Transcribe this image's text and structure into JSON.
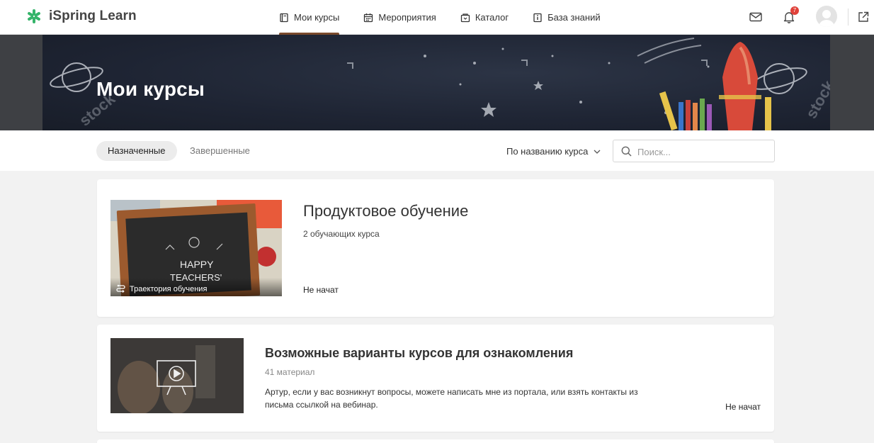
{
  "app": {
    "logo_text": "iSpring Learn"
  },
  "nav": {
    "items": [
      {
        "label": "Мои курсы",
        "icon": "book-icon",
        "active": true
      },
      {
        "label": "Мероприятия",
        "icon": "calendar-icon",
        "active": false
      },
      {
        "label": "Каталог",
        "icon": "catalog-icon",
        "active": false
      },
      {
        "label": "База знаний",
        "icon": "knowledge-icon",
        "active": false
      }
    ]
  },
  "header": {
    "notifications_count": "7",
    "icons": [
      "mail-icon",
      "bell-icon",
      "avatar",
      "external-link-icon"
    ]
  },
  "banner": {
    "title": "Мои курсы"
  },
  "filters": {
    "tabs": [
      {
        "label": "Назначенные",
        "active": true
      },
      {
        "label": "Завершенные",
        "active": false
      }
    ],
    "sort_label": "По названию курса",
    "search_placeholder": "Поиск...",
    "search_value": ""
  },
  "courses": [
    {
      "title": "Продуктовое обучение",
      "meta": "2 обучающих курса",
      "thumb_label": "Траектория обучения",
      "status": "Не начат"
    },
    {
      "title": "Возможные варианты курсов для ознакомления",
      "meta": "41 материал",
      "description": "Артур, если у вас возникнут вопросы, можете написать мне из портала, или взять контакты из письма ссылкой на вебинар.",
      "status": "Не начат"
    }
  ],
  "colors": {
    "accent": "#7a4a2c",
    "logo_green": "#35b46a",
    "badge": "#e0413a",
    "banner": "#1e2433"
  }
}
